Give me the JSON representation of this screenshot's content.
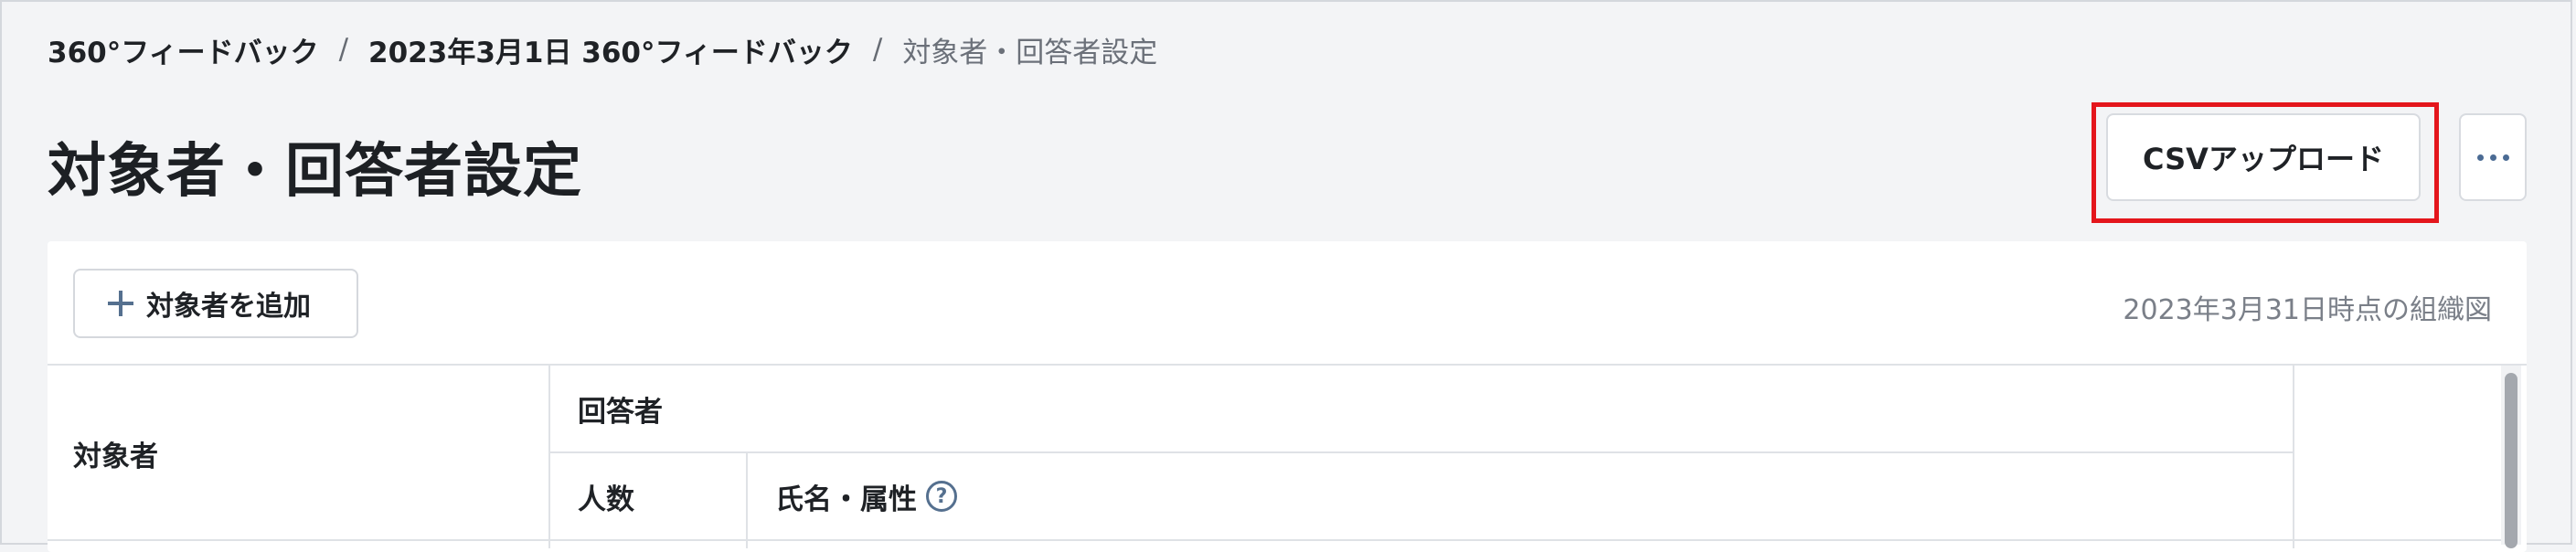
{
  "breadcrumb": {
    "items": [
      "360°フィードバック",
      "2023年3月1日 360°フィードバック"
    ],
    "separator": "/",
    "current": "対象者・回答者設定"
  },
  "page": {
    "title": "対象者・回答者設定"
  },
  "header_actions": {
    "csv_upload_label": "CSVアップロード",
    "more_icon": "more-horizontal-icon"
  },
  "toolbar": {
    "add_target_label": "対象者を追加",
    "add_icon": "plus-icon",
    "org_chart_date": "2023年3月31日時点の組織図"
  },
  "table": {
    "col_target": "対象者",
    "col_respondents": "回答者",
    "sub_col_count": "人数",
    "sub_col_name_attr": "氏名・属性",
    "help_icon": "question-circle-icon",
    "help_glyph": "?"
  },
  "colors": {
    "background": "#f3f4f6",
    "highlight": "#e4161c",
    "icon": "#55708f"
  }
}
